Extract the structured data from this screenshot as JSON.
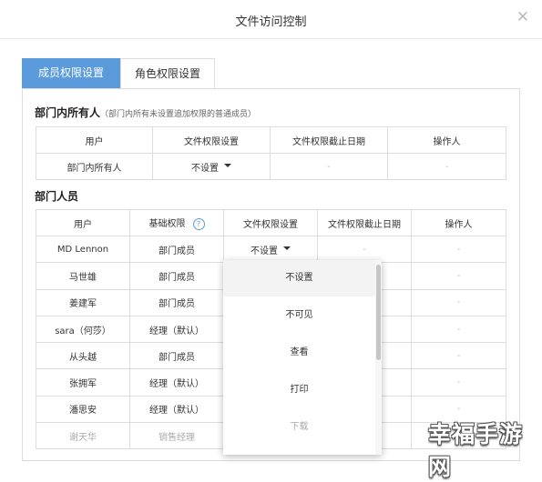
{
  "dialog": {
    "title": "文件访问控制",
    "close_glyph": "✕"
  },
  "tabs": [
    {
      "label": "成员权限设置",
      "active": true
    },
    {
      "label": "角色权限设置",
      "active": false
    }
  ],
  "owner_section": {
    "title": "部门内所有人",
    "hint": "（部门内所有未设置追加权限的普通成员）",
    "headers": [
      "用户",
      "文件权限设置",
      "文件权限截止日期",
      "操作人"
    ],
    "row": {
      "user": "部门内所有人",
      "permission": "不设置",
      "deadline": "-",
      "operator": "-"
    }
  },
  "members_section": {
    "title": "部门人员",
    "headers": [
      "用户",
      "基础权限",
      "文件权限设置",
      "文件权限截止日期",
      "操作人"
    ],
    "help_glyph": "?",
    "rows": [
      {
        "user": "MD Lennon",
        "base": "部门成员",
        "permission": "不设置",
        "deadline": "-",
        "operator": "-"
      },
      {
        "user": "马世雄",
        "base": "部门成员",
        "permission": "",
        "deadline": "",
        "operator": "-"
      },
      {
        "user": "姜建军",
        "base": "部门成员",
        "permission": "",
        "deadline": "",
        "operator": "-"
      },
      {
        "user": "sara（何莎）",
        "base": "经理（默认）",
        "permission": "",
        "deadline": "",
        "operator": "-"
      },
      {
        "user": "从头越",
        "base": "部门成员",
        "permission": "",
        "deadline": "",
        "operator": "-"
      },
      {
        "user": "张拥军",
        "base": "经理（默认）",
        "permission": "",
        "deadline": "",
        "operator": "-"
      },
      {
        "user": "潘思安",
        "base": "经理（默认）",
        "permission": "",
        "deadline": "",
        "operator": "-"
      },
      {
        "user": "谢天华",
        "base": "销售经理",
        "permission": "",
        "deadline": "",
        "operator": "-"
      }
    ]
  },
  "dropdown": {
    "options": [
      {
        "label": "不设置",
        "state": "highlighted"
      },
      {
        "label": "不可见",
        "state": "normal"
      },
      {
        "label": "查看",
        "state": "normal"
      },
      {
        "label": "打印",
        "state": "normal"
      },
      {
        "label": "下载",
        "state": "faded"
      }
    ]
  },
  "watermark": {
    "text": "幸福手游网"
  },
  "colors": {
    "accent": "#5b9bdb",
    "border": "#dcdcdc",
    "text": "#333333"
  }
}
